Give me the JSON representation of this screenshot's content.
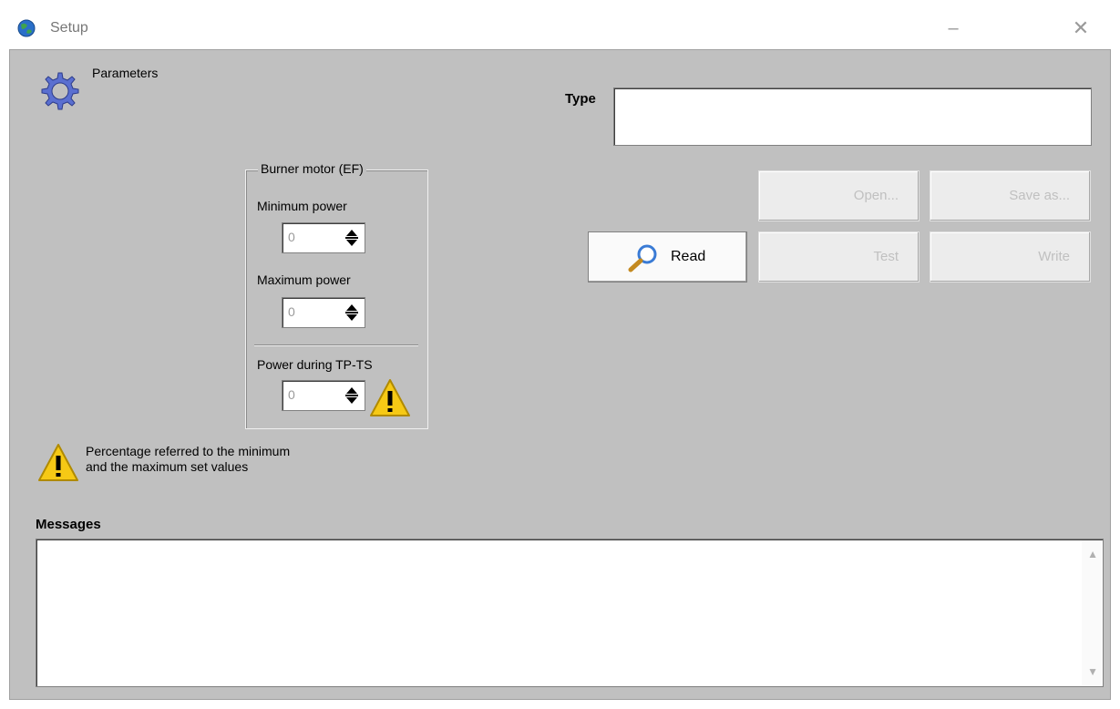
{
  "window": {
    "title": "Setup",
    "minimize_glyph": "–",
    "close_glyph": "✕",
    "icon": "globe-icon"
  },
  "params_group": {
    "label": "Parameters",
    "icon": "gear-icon"
  },
  "type": {
    "label": "Type",
    "value": ""
  },
  "burner": {
    "label": "Burner motor (EF)",
    "min_label": "Minimum power",
    "min_value": "0",
    "max_label": "Maximum power",
    "max_value": "0",
    "tp_label": "Power during TP-TS",
    "tp_value": "0"
  },
  "note": {
    "line1": "Percentage referred to the minimum",
    "line2": "and the maximum set values"
  },
  "buttons": {
    "read": "Read",
    "open": "Open...",
    "save_as": "Save as...",
    "test": "Test",
    "write": "Write"
  },
  "messages": {
    "label": "Messages",
    "text": ""
  },
  "colors": {
    "client_bg": "#c0c0c0",
    "warn_yellow": "#f6c915",
    "gear_blue": "#5a6fd0"
  }
}
